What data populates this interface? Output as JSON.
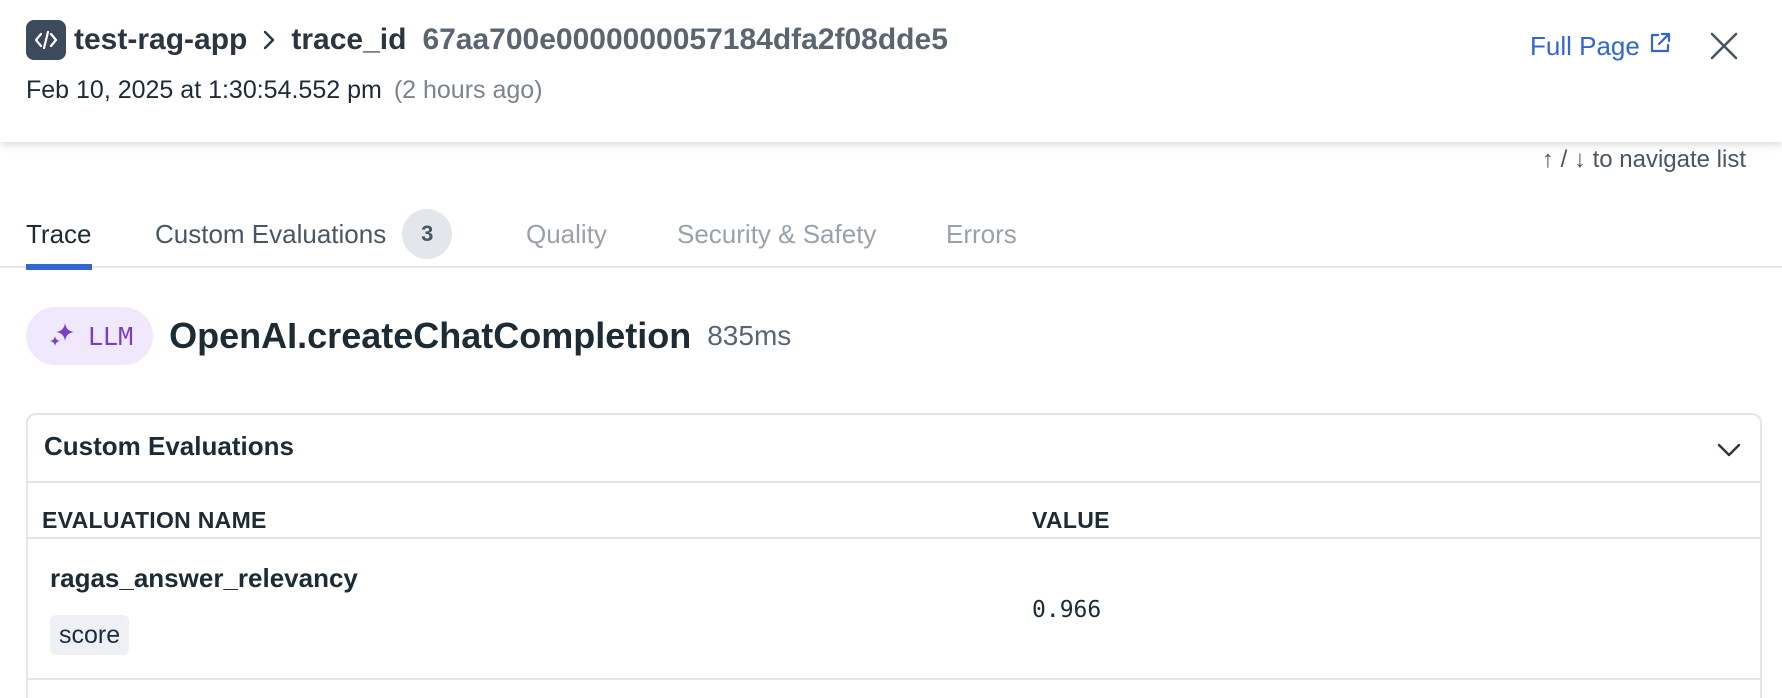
{
  "header": {
    "app_icon": "code-icon",
    "app_name": "test-rag-app",
    "separator_icon": "chevron-right-icon",
    "trace_label": "trace_id",
    "trace_id": "67aa700e0000000057184dfa2f08dde5",
    "timestamp": "Feb 10, 2025 at 1:30:54.552 pm",
    "relative_time": "(2 hours ago)",
    "full_page_label": "Full Page",
    "full_page_icon": "external-link-icon",
    "close_icon": "close-icon"
  },
  "nav_hint": "↑ / ↓ to navigate list",
  "tabs": [
    {
      "label": "Trace",
      "active": true
    },
    {
      "label": "Custom Evaluations",
      "count": "3"
    },
    {
      "label": "Quality"
    },
    {
      "label": "Security & Safety"
    },
    {
      "label": "Errors"
    }
  ],
  "span": {
    "kind_icon": "sparkle-icon",
    "kind_label": "LLM",
    "name": "OpenAI.createChatCompletion",
    "duration": "835ms"
  },
  "evaluations_panel": {
    "title": "Custom Evaluations",
    "collapse_icon": "chevron-down-icon",
    "columns": [
      "EVALUATION NAME",
      "VALUE"
    ],
    "rows": [
      {
        "name": "ragas_answer_relevancy",
        "tag": "score",
        "value": "0.966"
      }
    ]
  },
  "colors": {
    "accent": "#3266d1",
    "llm_badge_bg": "#f0e8fd",
    "llm_badge_fg": "#7a3ec9",
    "app_icon_bg": "#3d4a5c"
  }
}
